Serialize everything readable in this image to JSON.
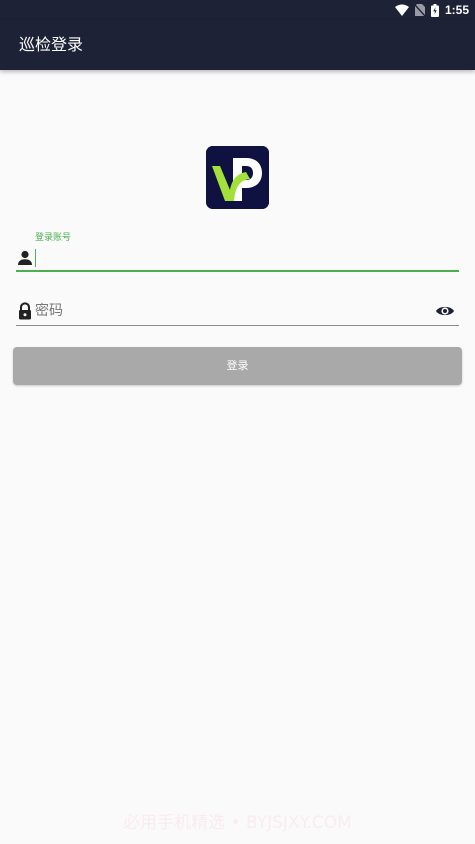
{
  "status_bar": {
    "time": "1:55"
  },
  "app_bar": {
    "title": "巡检登录"
  },
  "logo": {
    "icon": "vp-logo-icon",
    "background": "#0f1140",
    "accent": "#a4e03a"
  },
  "account_field": {
    "label": "登录账号",
    "value": "",
    "icon": "person-icon"
  },
  "password_field": {
    "placeholder": "密码",
    "value": "",
    "icon": "lock-icon",
    "toggle_icon": "eye-icon"
  },
  "login_button": {
    "label": "登录"
  },
  "watermark": {
    "text": "必用手机精选 • BYJSJXY.COM"
  },
  "colors": {
    "app_bar": "#1e2237",
    "accent_green": "#4caf50",
    "button_disabled": "#a9a9a9",
    "background": "#fafafa"
  }
}
